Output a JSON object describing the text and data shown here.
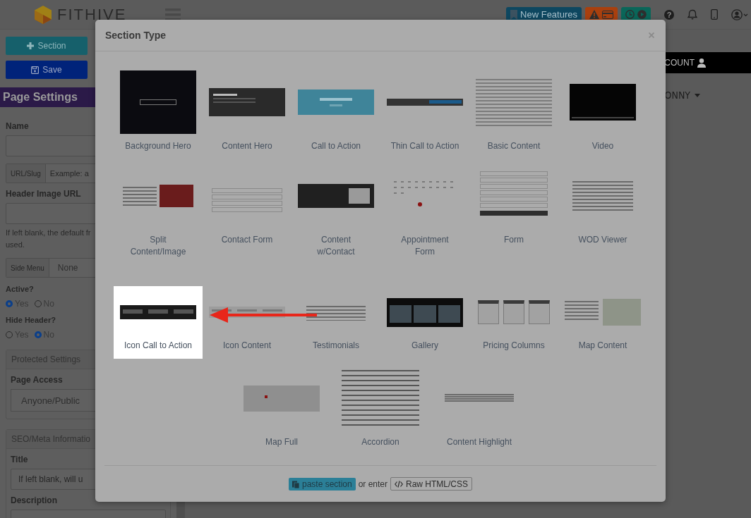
{
  "header": {
    "logo_text": "FITHIVE",
    "help_icon": "?",
    "buttons": [
      {
        "kind": "features",
        "label": "New Features"
      },
      {
        "kind": "alert"
      },
      {
        "kind": "timer"
      }
    ]
  },
  "sidebar": {
    "section_button": "Section",
    "save_button": "Save",
    "title": "Page Settings",
    "fields": [
      {
        "kind": "input",
        "label": "Name"
      },
      {
        "kind": "addon-input",
        "addon": "URL/Slug",
        "placeholder": "Example: a"
      },
      {
        "kind": "input",
        "label": "Header Image URL"
      },
      {
        "kind": "help",
        "lines": [
          "If left blank, the default fr",
          "used."
        ]
      },
      {
        "kind": "addon-select",
        "addon": "Side Menu",
        "value": "None"
      },
      {
        "kind": "radio",
        "label": "Active?",
        "options": [
          {
            "label": "Yes",
            "selected": true
          },
          {
            "label": "No",
            "selected": false
          }
        ]
      },
      {
        "kind": "radio",
        "label": "Hide Header?",
        "options": [
          {
            "label": "Yes",
            "selected": false
          },
          {
            "label": "No",
            "selected": true
          }
        ]
      },
      {
        "kind": "panel",
        "title": "Protected Settings",
        "fields": [
          {
            "kind": "select",
            "label": "Page Access",
            "value": "Anyone/Public"
          }
        ]
      },
      {
        "kind": "panel",
        "title": "SEO/Meta Informatio",
        "fields": [
          {
            "kind": "input",
            "label": "Title",
            "placeholder": "If left blank, will u"
          },
          {
            "kind": "input",
            "label": "Description"
          }
        ]
      }
    ]
  },
  "account_bar": {
    "label": "COUNT"
  },
  "user_menu": {
    "label": "ONNY"
  },
  "modal": {
    "title": "Section Type",
    "rows": [
      {
        "items": [
          {
            "label": "Background Hero",
            "kind": "hero-photo",
            "selected": false
          },
          {
            "label": "Content Hero",
            "kind": "hero-banner",
            "selected": false
          },
          {
            "label": "Call to Action",
            "kind": "cta",
            "selected": false
          },
          {
            "label": "Thin Call to Action",
            "kind": "thin-bar",
            "selected": false
          },
          {
            "label": "Basic Content",
            "kind": "text-page",
            "selected": false
          },
          {
            "label": "Video",
            "kind": "video",
            "selected": false
          }
        ]
      },
      {
        "items": [
          {
            "label": "Split Content/Image",
            "kind": "split",
            "selected": false
          },
          {
            "label": "Contact Form",
            "kind": "contact-form",
            "selected": false
          },
          {
            "label": "Content w/Contact",
            "kind": "content-contact",
            "selected": false
          },
          {
            "label": "Appointment Form",
            "kind": "calendar",
            "selected": false
          },
          {
            "label": "Form",
            "kind": "form",
            "selected": false
          },
          {
            "label": "WOD Viewer",
            "kind": "wod",
            "selected": false
          }
        ]
      },
      {
        "items": [
          {
            "label": "Icon Call to Action",
            "kind": "icon-bar",
            "selected": true
          },
          {
            "label": "Icon Content",
            "kind": "icon-columns",
            "selected": false
          },
          {
            "label": "Testimonials",
            "kind": "testimonial",
            "selected": false
          },
          {
            "label": "Gallery",
            "kind": "gallery",
            "selected": false
          },
          {
            "label": "Pricing Columns",
            "kind": "pricing",
            "selected": false
          },
          {
            "label": "Map Content",
            "kind": "map-content",
            "selected": false
          }
        ]
      },
      {
        "items": [
          {
            "label": "Map Full",
            "kind": "map",
            "selected": false
          },
          {
            "label": "Accordion",
            "kind": "accordion",
            "selected": false
          },
          {
            "label": "Content Highlight",
            "kind": "highlight",
            "selected": false
          }
        ]
      }
    ],
    "paste_button": "paste section",
    "separator": "or enter",
    "raw_button": "Raw HTML/CSS"
  }
}
